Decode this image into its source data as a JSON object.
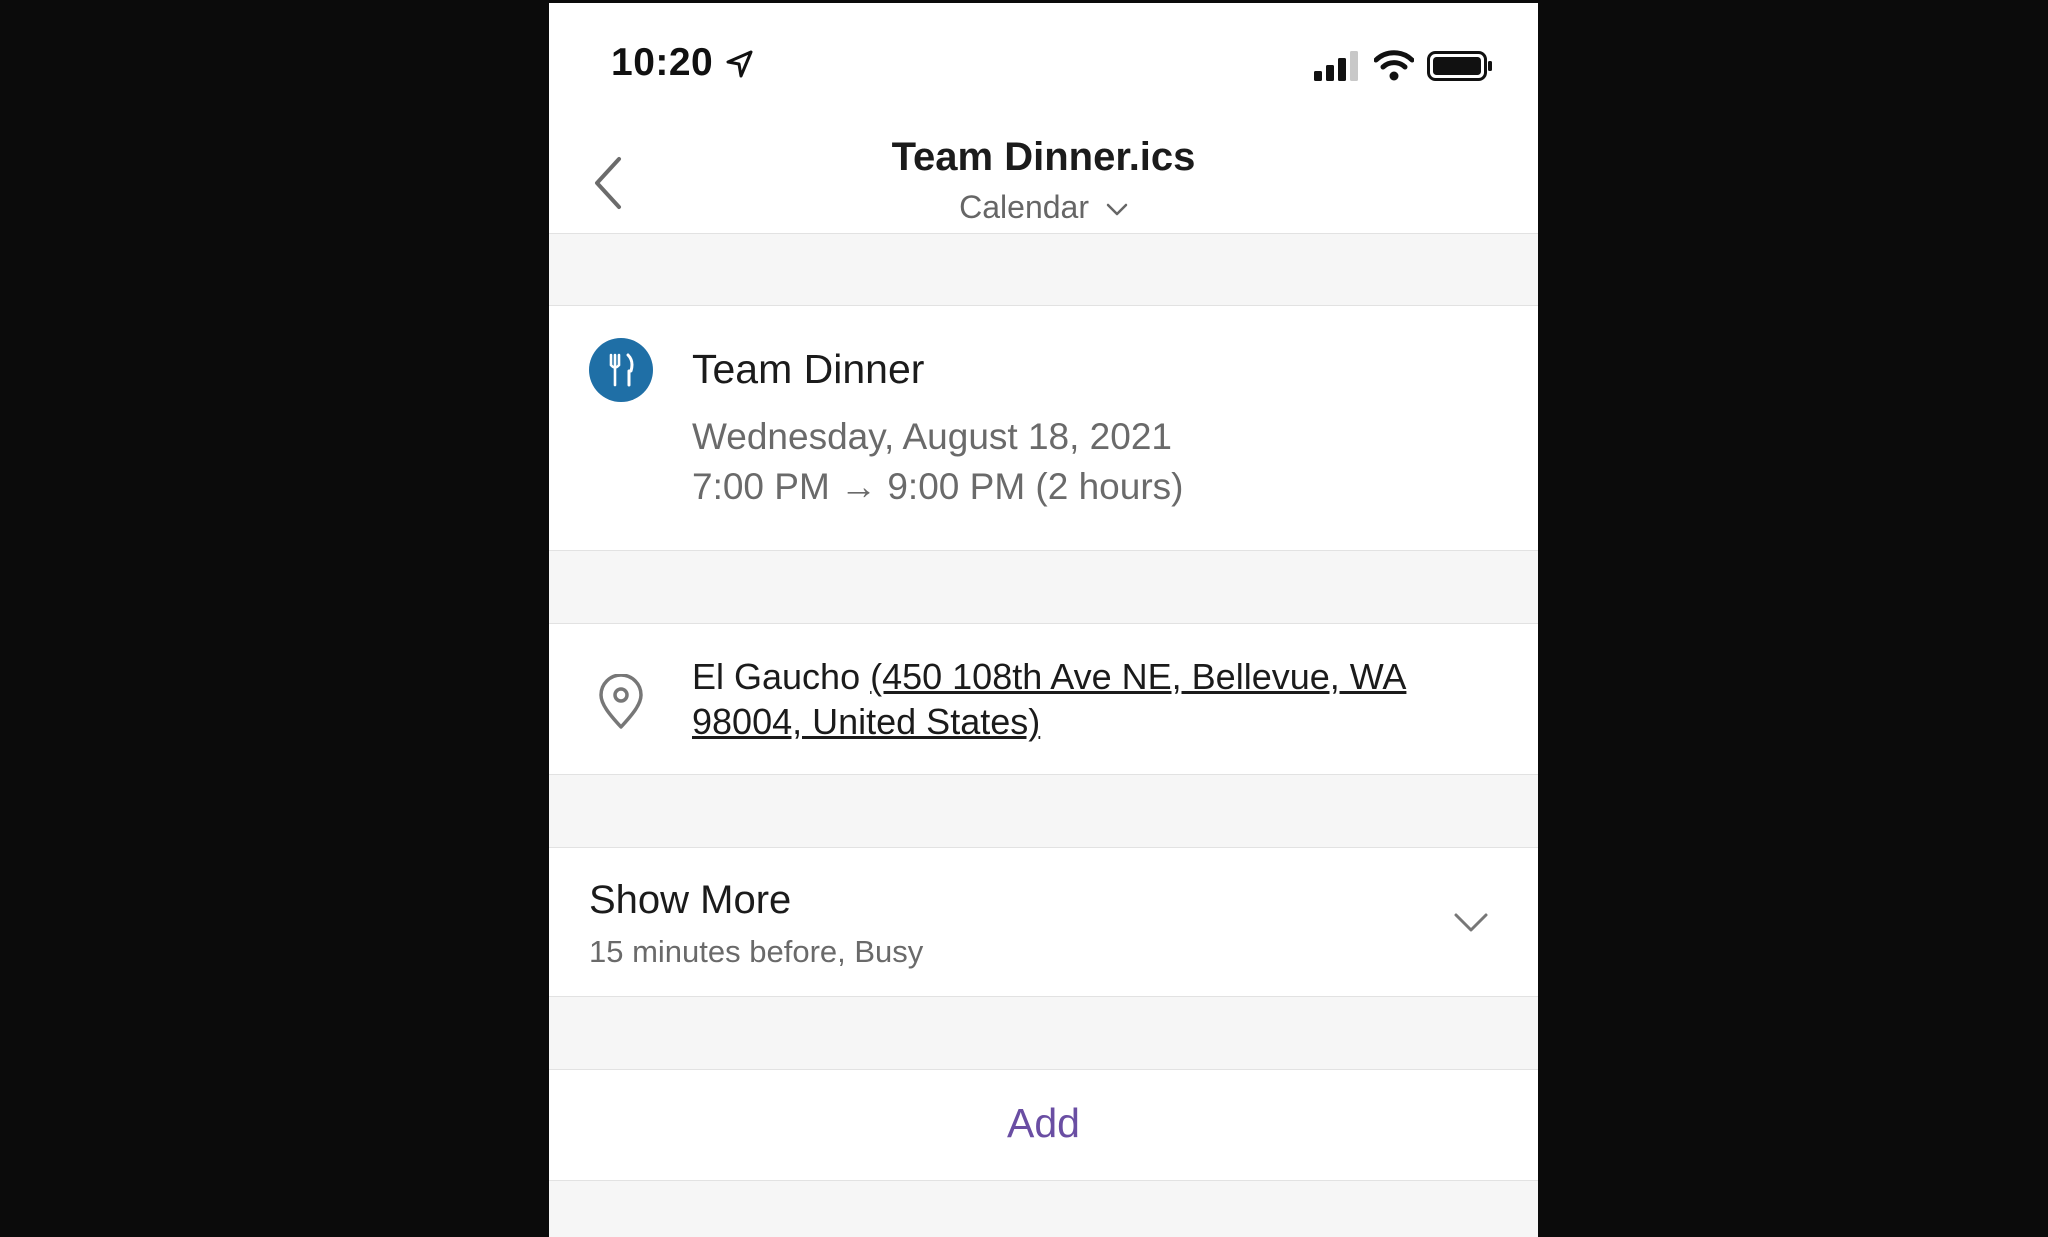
{
  "status_bar": {
    "time": "10:20"
  },
  "header": {
    "title": "Team Dinner.ics",
    "subtitle": "Calendar"
  },
  "event": {
    "title": "Team Dinner",
    "date": "Wednesday, August 18, 2021",
    "time_range": "7:00 PM → 9:00 PM (2 hours)",
    "icon": "fork-knife-icon",
    "icon_color": "#1f6fa6"
  },
  "location": {
    "name": "El Gaucho ",
    "address": "(450 108th Ave NE, Bellevue, WA 98004, United States)"
  },
  "show_more": {
    "label": "Show More",
    "details": "15 minutes before, Busy"
  },
  "actions": {
    "add_label": "Add",
    "add_color": "#6a4ea3"
  }
}
